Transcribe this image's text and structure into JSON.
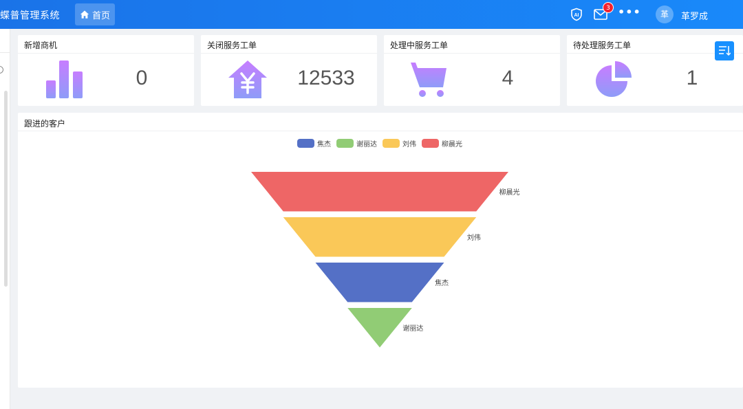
{
  "header": {
    "brand": "蝶普管理系统",
    "home_tab": "首页",
    "mail_badge": "3",
    "more": "•••",
    "avatar_initial": "革",
    "username": "革罗成"
  },
  "cards": [
    {
      "title": "新增商机",
      "value": "0",
      "icon": "bar-chart-icon"
    },
    {
      "title": "关闭服务工单",
      "value": "12533",
      "icon": "yen-house-icon"
    },
    {
      "title": "处理中服务工单",
      "value": "4",
      "icon": "shopping-cart-icon"
    },
    {
      "title": "待处理服务工单",
      "value": "1",
      "icon": "pie-chart-icon"
    }
  ],
  "panel": {
    "title": "跟进的客户"
  },
  "colors": {
    "topbar": "#1a73e8",
    "icon_gradient_top": "#c77dff",
    "icon_gradient_bottom": "#8e9cf8"
  },
  "chart_data": {
    "type": "funnel",
    "legend": [
      {
        "name": "焦杰",
        "color": "#5470c6"
      },
      {
        "name": "谢丽达",
        "color": "#91cc75"
      },
      {
        "name": "刘伟",
        "color": "#fac858"
      },
      {
        "name": "柳晨光",
        "color": "#ee6666"
      }
    ],
    "stages": [
      {
        "name": "柳晨光",
        "rank": 4,
        "color": "#ee6666"
      },
      {
        "name": "刘伟",
        "rank": 3,
        "color": "#fac858"
      },
      {
        "name": "焦杰",
        "rank": 2,
        "color": "#5470c6"
      },
      {
        "name": "谢丽达",
        "rank": 1,
        "color": "#91cc75"
      }
    ],
    "legend_position": "top-center"
  }
}
